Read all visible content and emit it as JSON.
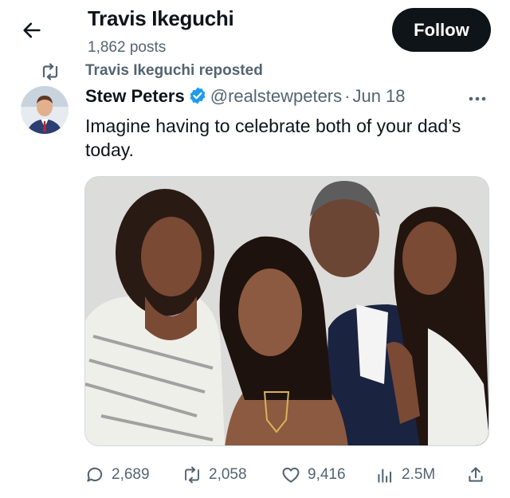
{
  "header": {
    "profile_name": "Travis Ikeguchi",
    "post_count": "1,862 posts",
    "follow_label": "Follow",
    "back_icon": "arrow-left-icon"
  },
  "repost": {
    "text": "Travis Ikeguchi reposted",
    "icon": "repost-icon"
  },
  "tweet": {
    "author_name": "Stew Peters",
    "handle": "@realstewpeters",
    "separator": "·",
    "date": "Jun 18",
    "text": "Imagine having to celebrate both of your dad’s today.",
    "verified_color": "#1d9bf0"
  },
  "actions": {
    "replies": "2,689",
    "reposts": "2,058",
    "likes": "9,416",
    "views": "2.5M"
  },
  "colors": {
    "text_primary": "#0f1419",
    "text_secondary": "#536471",
    "follow_bg": "#0f1419"
  }
}
